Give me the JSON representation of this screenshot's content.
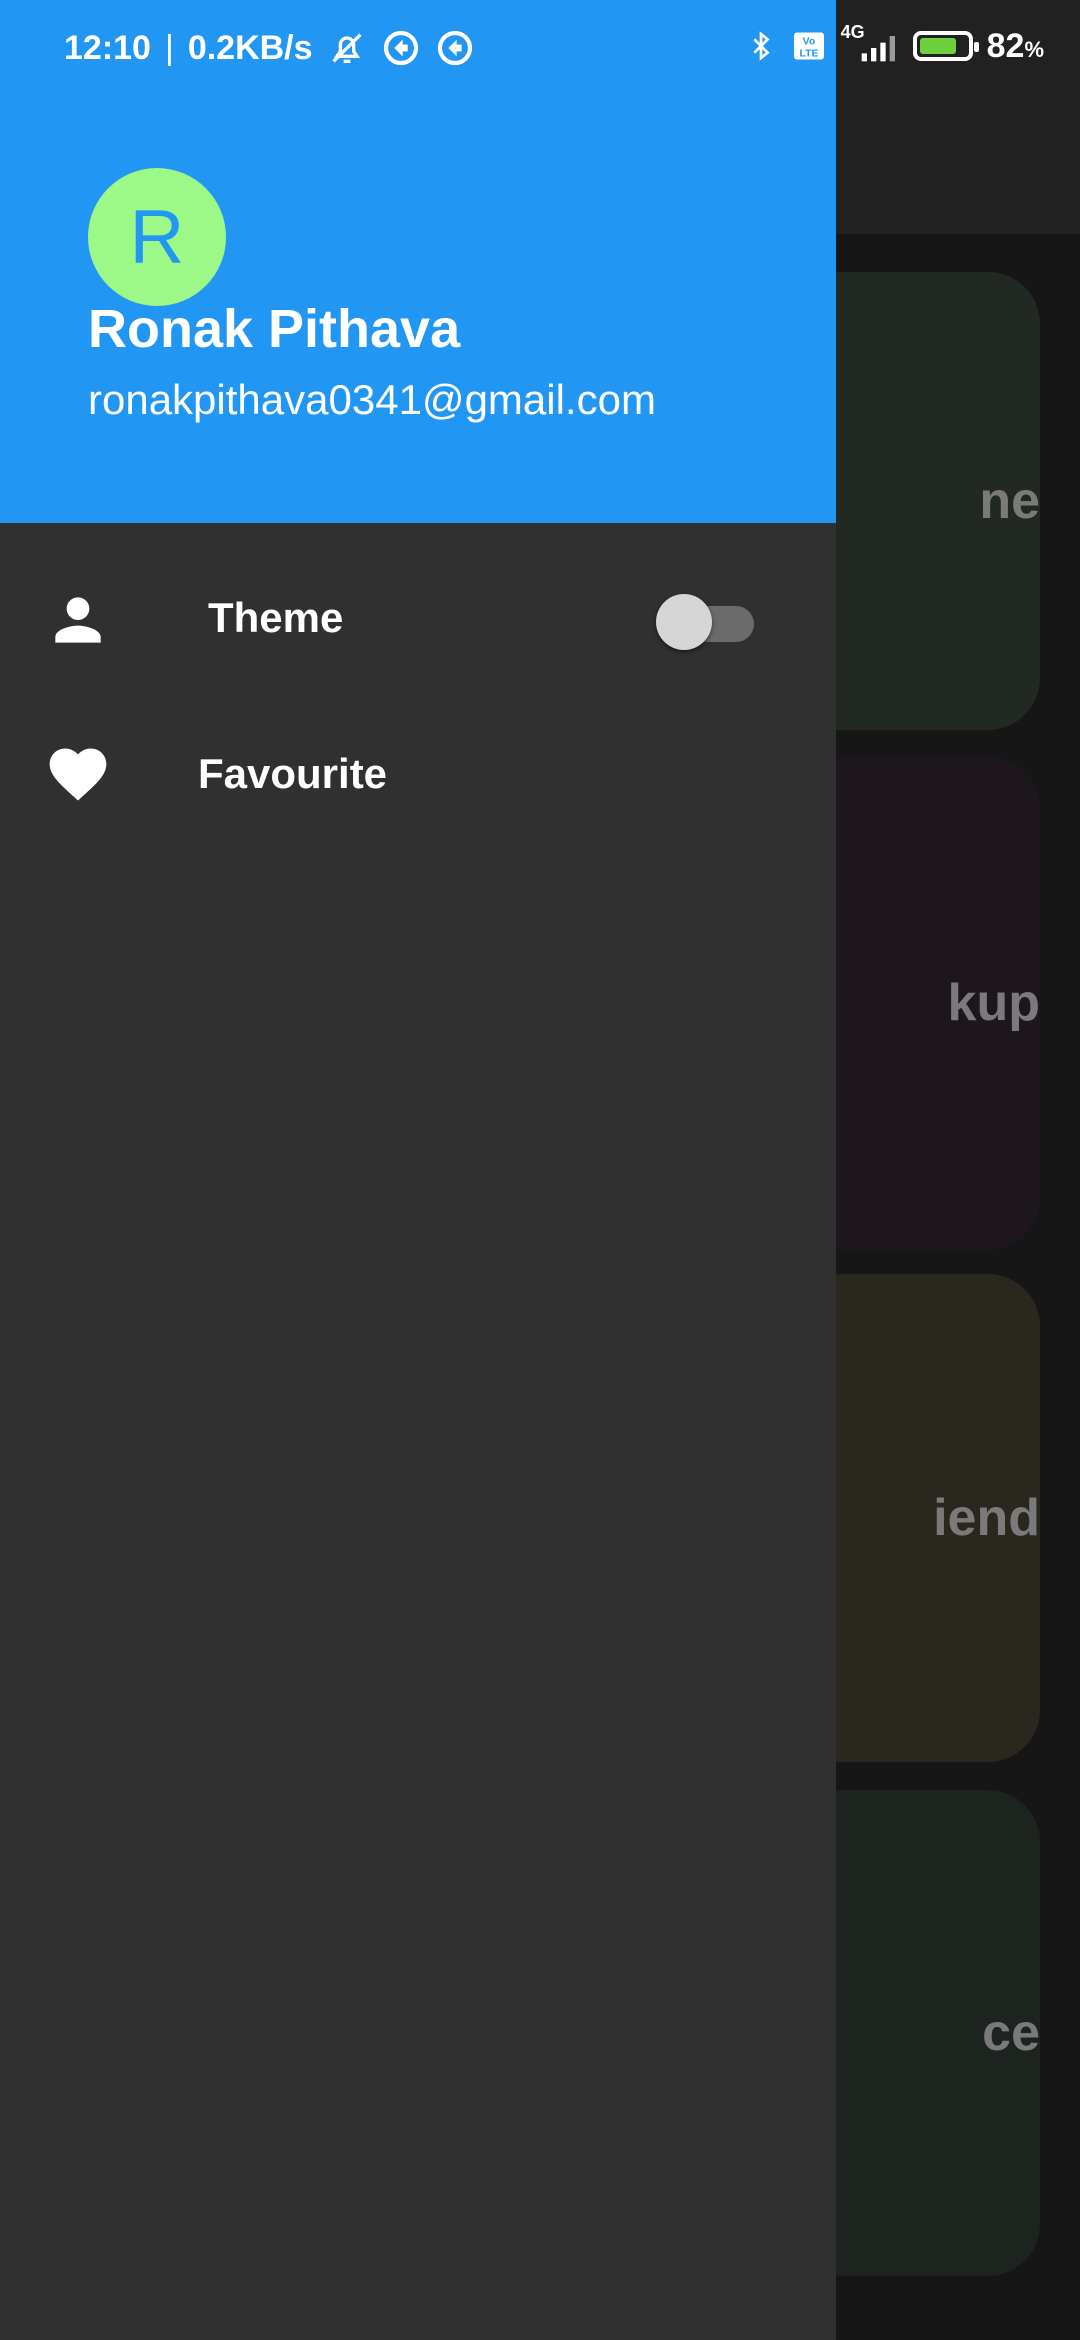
{
  "status_bar": {
    "time": "12:10",
    "separator": "|",
    "speed": "0.2KB/s",
    "network": "4G",
    "battery_level": 0.82,
    "battery_text": "82",
    "battery_unit": "%",
    "icons": [
      "silent-bell-icon",
      "sync-icon",
      "sync-icon",
      "bluetooth-icon",
      "volte-icon",
      "signal-icon",
      "battery-icon"
    ]
  },
  "background": {
    "cards": [
      {
        "label": "ne",
        "color": "#222822"
      },
      {
        "label": "kup",
        "color": "#1d161d"
      },
      {
        "label": "iend",
        "color": "#29271e"
      },
      {
        "label": "ce",
        "color": "#1d231e"
      }
    ]
  },
  "drawer": {
    "avatar_letter": "R",
    "user_name": "Ronak Pithava",
    "user_email": "ronakpithava0341@gmail.com",
    "items": [
      {
        "label": "Theme",
        "icon": "person-icon",
        "toggle": false
      },
      {
        "label": "Favourite",
        "icon": "heart-icon"
      }
    ]
  },
  "colors": {
    "header": "#2196F3",
    "avatar_bg": "#9cf988",
    "drawer_bg": "#303030"
  }
}
